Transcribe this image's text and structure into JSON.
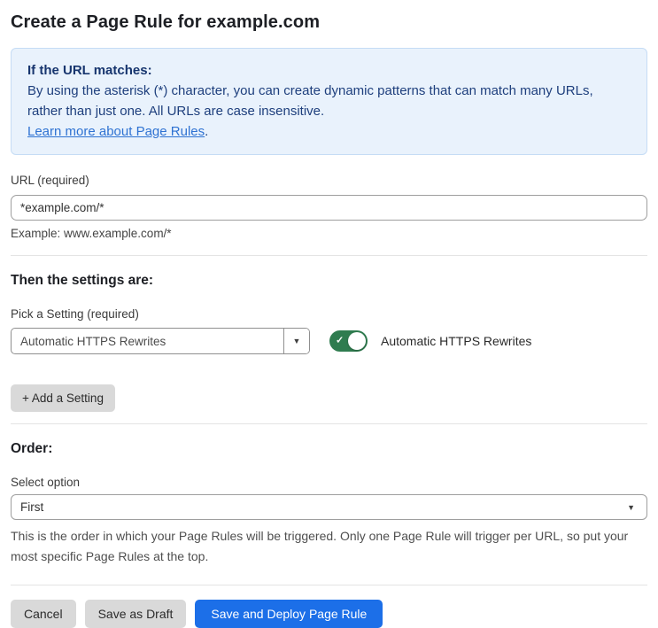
{
  "page": {
    "title": "Create a Page Rule for example.com"
  },
  "notice": {
    "heading": "If the URL matches:",
    "body": "By using the asterisk (*) character, you can create dynamic patterns that can match many URLs, rather than just one. All URLs are case insensitive.",
    "link_label": "Learn more about Page Rules",
    "link_suffix": "."
  },
  "url_field": {
    "label": "URL (required)",
    "value": "*example.com/*",
    "helper": "Example: www.example.com/*"
  },
  "settings": {
    "heading": "Then the settings are:",
    "picker_label": "Pick a Setting (required)",
    "selected_setting": "Automatic HTTPS Rewrites",
    "toggle_state": "on",
    "toggle_label": "Automatic HTTPS Rewrites",
    "add_setting_label": "+ Add a Setting"
  },
  "order": {
    "heading": "Order:",
    "label": "Select option",
    "selected_option": "First",
    "helper": "This is the order in which your Page Rules will be triggered. Only one Page Rule will trigger per URL, so put your most specific Page Rules at the top."
  },
  "footer": {
    "cancel_label": "Cancel",
    "save_draft_label": "Save as Draft",
    "save_deploy_label": "Save and Deploy Page Rule"
  },
  "icons": {
    "dropdown_arrow": "▼",
    "check": "✓"
  },
  "colors": {
    "notice_bg": "#e9f2fc",
    "notice_border": "#c5dcf5",
    "notice_text": "#1e3f7d",
    "link": "#2e72d2",
    "toggle_on": "#2f7c4f",
    "primary_button": "#1c6fe8",
    "secondary_button": "#d9d9d9"
  }
}
